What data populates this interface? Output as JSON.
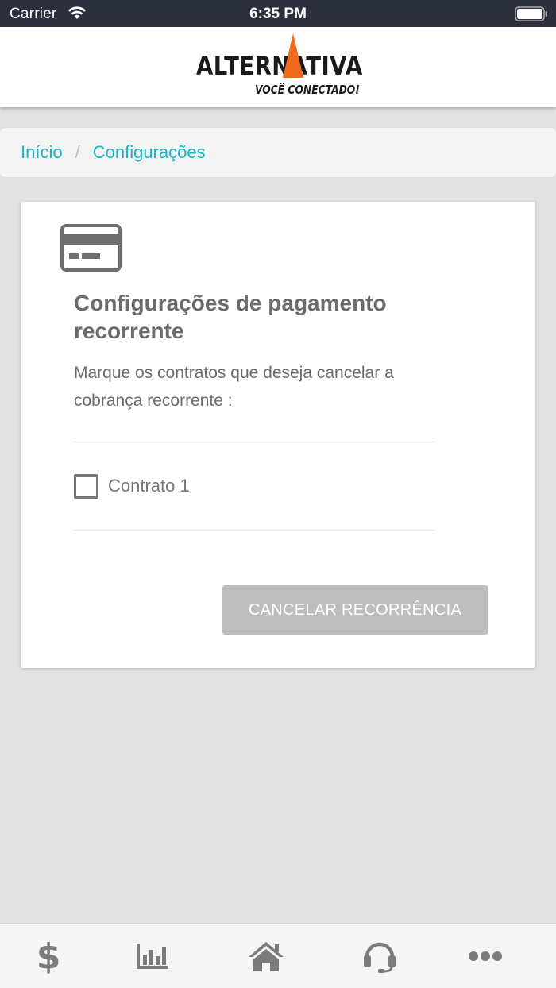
{
  "status_bar": {
    "carrier": "Carrier",
    "time": "6:35 PM"
  },
  "header": {
    "logo_text": "ALTERNATIVA",
    "logo_tagline": "VOCÊ CONECTADO!",
    "logo_accent_color": "#f26a1b"
  },
  "breadcrumb": {
    "items": [
      "Início",
      "Configurações"
    ],
    "separator": "/"
  },
  "card": {
    "icon": "credit-card-icon",
    "title": "Configurações de pagamento recorrente",
    "description": "Marque os contratos que deseja cancelar a cobrança recorrente :",
    "contracts": [
      {
        "label": "Contrato 1",
        "checked": false
      }
    ],
    "cancel_button_label": "CANCELAR RECORRÊNCIA"
  },
  "tab_bar": {
    "items": [
      {
        "icon": "dollar-icon",
        "glyph": "$"
      },
      {
        "icon": "bar-chart-icon"
      },
      {
        "icon": "home-icon"
      },
      {
        "icon": "headset-icon"
      },
      {
        "icon": "more-icon"
      }
    ]
  },
  "colors": {
    "link": "#18b6c4",
    "button_disabled": "#bdbdbd",
    "status_bar": "#2c2f3c"
  }
}
